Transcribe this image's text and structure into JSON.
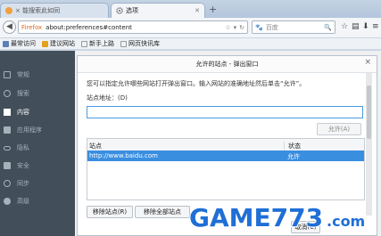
{
  "tabs": [
    {
      "label": "×   能搜索此如同"
    },
    {
      "label": "选项"
    }
  ],
  "new_tab": "+",
  "urlbar": {
    "brand": "Firefox",
    "url": "about:preferences#content"
  },
  "search": {
    "placeholder": "百度"
  },
  "bookmarks": [
    "最常访问",
    "建议网站",
    "新手上路",
    "网页快讯库"
  ],
  "sidebar": {
    "items": [
      {
        "label": "常规",
        "icon": "home-icon"
      },
      {
        "label": "搜索",
        "icon": "search-icon"
      },
      {
        "label": "内容",
        "icon": "content-icon",
        "active": true
      },
      {
        "label": "应用程序",
        "icon": "applications-icon"
      },
      {
        "label": "隐私",
        "icon": "privacy-icon"
      },
      {
        "label": "安全",
        "icon": "lock-icon"
      },
      {
        "label": "同步",
        "icon": "sync-icon"
      },
      {
        "label": "高级",
        "icon": "advanced-icon"
      }
    ]
  },
  "dialog": {
    "title": "允许的站点 - 弹出窗口",
    "close": "×",
    "description": "您可以指定允许哪些网站打开弹出窗口。输入网站的准确地址然后单击“允许”。",
    "address_label": "站点地址：(D)",
    "address_value": "",
    "allow_button": "允许(A)",
    "columns": [
      "站点",
      "状态"
    ],
    "rows": [
      {
        "site": "http://www.baidu.com",
        "status": "允许"
      }
    ],
    "remove_button": "移除站点(R)",
    "remove_all_button": "移除全部站点",
    "cancel_button": "取消(C)"
  },
  "watermark": {
    "text": "GAME773.com"
  },
  "colors": {
    "accent": "#3a8ee0",
    "sidebar": "#424f5a",
    "watermark": "#1f6fd6"
  }
}
